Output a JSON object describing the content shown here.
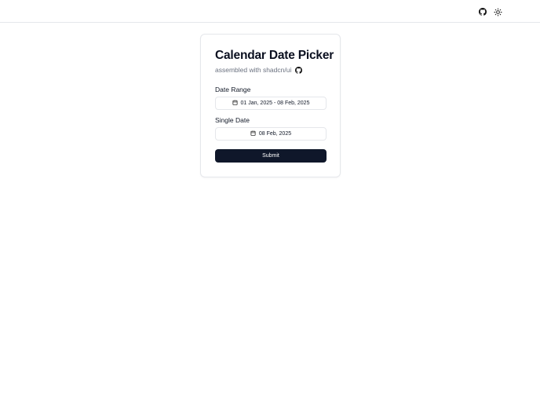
{
  "header": {
    "github_icon": "github-icon",
    "theme_icon": "sun-icon"
  },
  "card": {
    "title": "Calendar Date Picker",
    "subtitle": "assembled with shadcn/ui",
    "date_range": {
      "label": "Date Range",
      "value": "01 Jan, 2025 - 08 Feb, 2025",
      "icon": "calendar-icon"
    },
    "single_date": {
      "label": "Single Date",
      "value": "08 Feb, 2025",
      "icon": "calendar-icon"
    },
    "submit_label": "Submit"
  },
  "colors": {
    "primary": "#0f172a",
    "border": "#e5e7eb",
    "muted_text": "#6b7280"
  }
}
